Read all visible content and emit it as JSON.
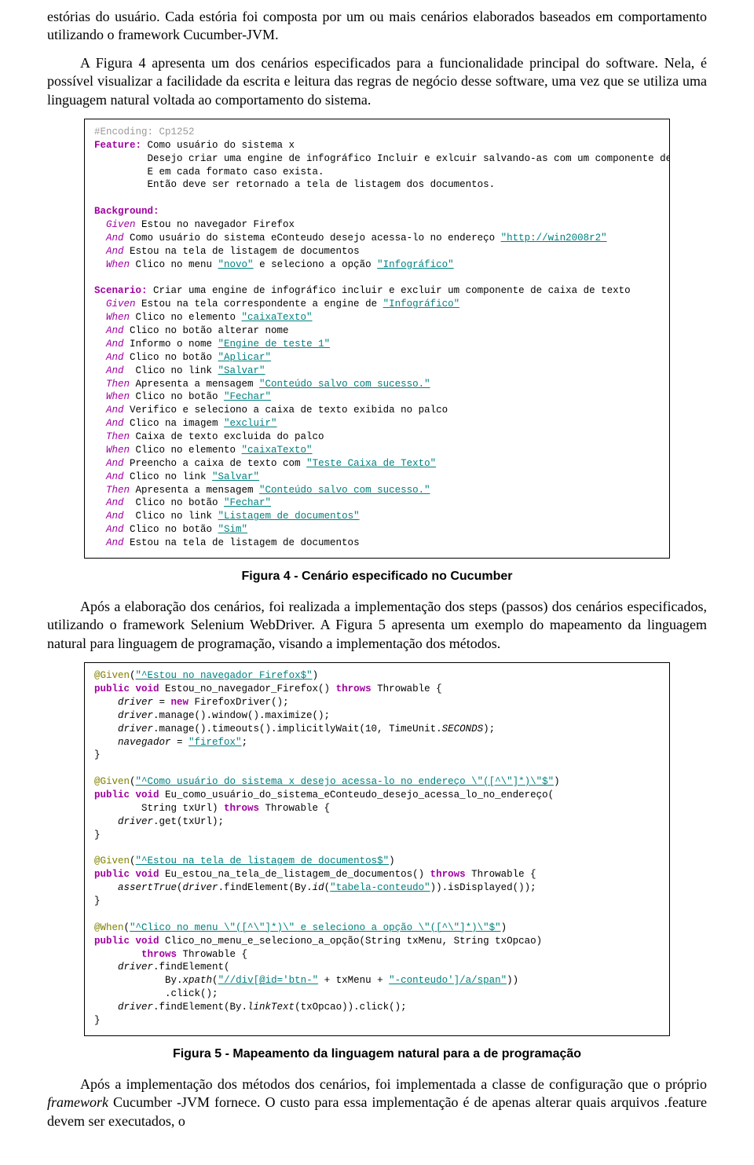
{
  "para1": "estórias do usuário. Cada estória foi composta por um ou mais cenários elaborados baseados em comportamento utilizando o framework Cucumber-JVM.",
  "para2": "A Figura 4 apresenta um dos cenários especificados para a funcionalidade principal do software. Nela, é possível visualizar a facilidade da escrita e leitura das regras de negócio desse software, uma vez que se utiliza uma linguagem natural voltada ao comportamento do sistema.",
  "fig4caption": "Figura 4 - Cenário especificado no Cucumber",
  "para3": "Após a elaboração dos cenários, foi realizada a implementação dos steps (passos) dos cenários especificados, utilizando o framework Selenium WebDriver. A Figura 5 apresenta um exemplo do mapeamento da linguagem natural para linguagem de programação, visando a implementação dos métodos.",
  "fig5caption": "Figura 5 - Mapeamento da linguagem natural para a de programação",
  "para4_a": "Após a implementação dos métodos dos cenários, foi implementada a classe de configuração que o próprio ",
  "para4_b": "framework",
  "para4_c": " Cucumber -JVM fornece. O custo para essa implementação é de apenas alterar quais arquivos .feature devem ser executados, o",
  "gherkin": {
    "l01a": "#Encoding: Cp1252",
    "l02a": "Feature:",
    "l02b": " Como usuário do sistema x",
    "l03": "         Desejo criar uma engine de infográfico Incluir e exlcuir salvando-as com um componente de cada vez",
    "l04": "         E em cada formato caso exista.",
    "l05": "         Então deve ser retornado a tela de listagem dos documentos.",
    "l07a": "Background:",
    "l08a": "  Given",
    "l08b": " Estou no navegador Firefox",
    "l09a": "  And",
    "l09b": " Como usuário do sistema eConteudo desejo acessa-lo no endereço ",
    "l09c": "\"http://win2008r2\"",
    "l10a": "  And",
    "l10b": " Estou na tela de listagem de documentos",
    "l11a": "  When",
    "l11b": " Clico no menu ",
    "l11c": "\"novo\"",
    "l11d": " e seleciono a opção ",
    "l11e": "\"Infográfico\"",
    "l13a": "Scenario:",
    "l13b": " Criar uma engine de infográfico incluir e excluir um componente de caixa de texto",
    "l14a": "  Given",
    "l14b": " Estou na tela correspondente a engine de ",
    "l14c": "\"Infográfico\"",
    "l15a": "  When",
    "l15b": " Clico no elemento ",
    "l15c": "\"caixaTexto\"",
    "l16a": "  And",
    "l16b": " Clico no botão alterar nome",
    "l17a": "  And",
    "l17b": " Informo o nome ",
    "l17c": "\"Engine_de_teste_1\"",
    "l18a": "  And",
    "l18b": " Clico no botão ",
    "l18c": "\"Aplicar\"",
    "l19a": "  And",
    "l19b": "  Clico no link ",
    "l19c": "\"Salvar\"",
    "l20a": "  Then",
    "l20b": " Apresenta a mensagem ",
    "l20c": "\"Conteúdo salvo com sucesso.\"",
    "l21a": "  When",
    "l21b": " Clico no botão ",
    "l21c": "\"Fechar\"",
    "l22a": "  And",
    "l22b": " Verifico e seleciono a caixa de texto exibida no palco",
    "l23a": "  And",
    "l23b": " Clico na imagem ",
    "l23c": "\"excluir\"",
    "l24a": "  Then",
    "l24b": " Caixa de texto excluida do palco",
    "l25a": "  When",
    "l25b": " Clico no elemento ",
    "l25c": "\"caixaTexto\"",
    "l26a": "  And",
    "l26b": " Preencho a caixa de texto com ",
    "l26c": "\"Teste Caixa de Texto\"",
    "l27a": "  And",
    "l27b": " Clico no link ",
    "l27c": "\"Salvar\"",
    "l28a": "  Then",
    "l28b": " Apresenta a mensagem ",
    "l28c": "\"Conteúdo salvo com sucesso.\"",
    "l29a": "  And",
    "l29b": "  Clico no botão ",
    "l29c": "\"Fechar\"",
    "l30a": "  And",
    "l30b": "  Clico no link ",
    "l30c": "\"Listagem de documentos\"",
    "l31a": "  And",
    "l31b": " Clico no botão ",
    "l31c": "\"Sim\"",
    "l32a": "  And",
    "l32b": " Estou na tela de listagem de documentos"
  },
  "java": {
    "l01a": "@Given",
    "l01b": "(",
    "l01c": "\"^Estou no navegador Firefox$\"",
    "l01d": ")",
    "l02a": "public void ",
    "l02b": "Estou_no_navegador_Firefox() ",
    "l02c": "throws ",
    "l02d": "Throwable {",
    "l03a": "    driver",
    "l03b": " = ",
    "l03c": "new ",
    "l03d": "FirefoxDriver();",
    "l04a": "    driver",
    "l04b": ".manage().window().maximize();",
    "l05a": "    driver",
    "l05b": ".manage().timeouts().implicitlyWait(10, TimeUnit.",
    "l05c": "SECONDS",
    "l05d": ");",
    "l06a": "    navegador",
    "l06b": " = ",
    "l06c": "\"firefox\"",
    "l06d": ";",
    "l07": "}",
    "l09a": "@Given",
    "l09b": "(",
    "l09c": "\"^Como usuário do sistema x desejo acessa-lo no endereço \\\"([^\\\"]*)\\\"$\"",
    "l09d": ")",
    "l10a": "public void ",
    "l10b": "Eu_como_usuário_do_sistema_eConteudo_desejo_acessa_lo_no_endereço(",
    "l11a": "        String txUrl) ",
    "l11b": "throws ",
    "l11c": "Throwable {",
    "l12a": "    driver",
    "l12b": ".get(txUrl);",
    "l13": "}",
    "l15a": "@Given",
    "l15b": "(",
    "l15c": "\"^Estou na tela de listagem de documentos$\"",
    "l15d": ")",
    "l16a": "public void ",
    "l16b": "Eu_estou_na_tela_de_listagem_de_documentos() ",
    "l16c": "throws ",
    "l16d": "Throwable {",
    "l17a": "    assertTrue",
    "l17b": "(",
    "l17c": "driver",
    "l17d": ".findElement(By.",
    "l17e": "id",
    "l17f": "(",
    "l17g": "\"tabela-conteudo\"",
    "l17h": ")).isDisplayed());",
    "l18": "}",
    "l20a": "@When",
    "l20b": "(",
    "l20c": "\"^Clico no menu \\\"([^\\\"]*)\\\" e seleciono a opção \\\"([^\\\"]*)\\\"$\"",
    "l20d": ")",
    "l21a": "public void ",
    "l21b": "Clico_no_menu_e_seleciono_a_opção(String txMenu, String txOpcao)",
    "l22a": "        throws ",
    "l22b": "Throwable {",
    "l23a": "    driver",
    "l23b": ".findElement(",
    "l24a": "            By.",
    "l24b": "xpath",
    "l24c": "(",
    "l24d": "\"//div[@id='btn-\"",
    "l24e": " + txMenu + ",
    "l24f": "\"-conteudo']/a/span\"",
    "l24g": "))",
    "l25": "            .click();",
    "l26a": "    driver",
    "l26b": ".findElement(By.",
    "l26c": "linkText",
    "l26d": "(txOpcao)).click();",
    "l27": "}"
  }
}
